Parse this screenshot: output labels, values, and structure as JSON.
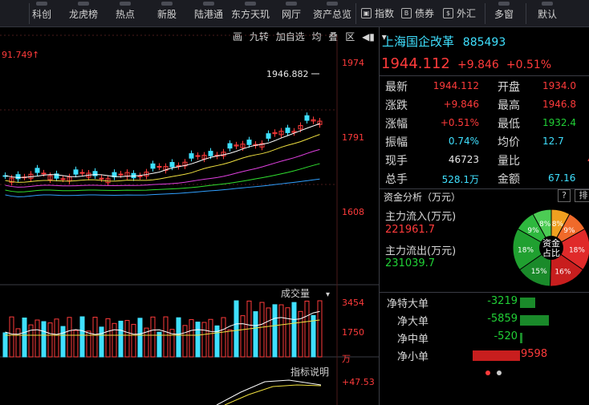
{
  "toolbar": {
    "items": [
      {
        "label": "科创"
      },
      {
        "label": "龙虎榜"
      },
      {
        "label": "热点"
      },
      {
        "label": "新股"
      },
      {
        "label": "陆港通"
      },
      {
        "label": "东方天玑"
      },
      {
        "label": "网厅"
      },
      {
        "label": "资产总览"
      }
    ],
    "small_items": [
      {
        "label": "指数",
        "icon": "chart-box-icon"
      },
      {
        "label": "债券",
        "icon": "bond-box-icon"
      },
      {
        "label": "外汇",
        "icon": "forex-box-icon"
      }
    ],
    "right_items": [
      {
        "label": "多窗"
      },
      {
        "label": "默认"
      }
    ]
  },
  "chart_tools": {
    "draw": "画",
    "nine_turn": "九转",
    "add_self": "加自选",
    "avg": "均",
    "overlay": "叠",
    "range": "区"
  },
  "price_chart": {
    "left_label": "91.749",
    "max_label": "1946.882",
    "y_ticks": [
      "1974",
      "1791",
      "1608"
    ]
  },
  "volume_chart": {
    "title": "成交量",
    "y_ticks": [
      "3454",
      "1750"
    ],
    "unit": "万"
  },
  "indicator_chart": {
    "title": "指标说明",
    "y_tick": "+47.53"
  },
  "quote": {
    "name": "上海国企改革",
    "code": "885493",
    "price": "1944.112",
    "change": "+9.846",
    "pct": "+0.51%",
    "rows": [
      {
        "l1": "最新",
        "v1": "1944.112",
        "l2": "开盘",
        "v2": "1934.0"
      },
      {
        "l1": "涨跌",
        "v1": "+9.846",
        "l2": "最高",
        "v2": "1946.8"
      },
      {
        "l1": "涨幅",
        "v1": "+0.51%",
        "l2": "最低",
        "v2": "1932.4"
      },
      {
        "l1": "振幅",
        "v1": "0.74%",
        "l2": "均价",
        "v2": "12.7"
      },
      {
        "l1": "现手",
        "v1": "46723",
        "l2": "量比",
        "v2": "4"
      },
      {
        "l1": "总手",
        "v1": "528.1万",
        "l2": "金额",
        "v2": "67.16"
      }
    ]
  },
  "fund": {
    "title": "资金分析（万元）",
    "help": "?",
    "sort": "排",
    "inflow_label": "主力流入(万元)",
    "inflow_value": "221961.7",
    "outflow_label": "主力流出(万元)",
    "outflow_value": "231039.7",
    "pie_center": [
      "资金",
      "占比"
    ],
    "pie_slices": [
      {
        "label": "8%",
        "color": "#f0a020"
      },
      {
        "label": "9%",
        "color": "#f06a2a"
      },
      {
        "label": "18%",
        "color": "#e02a2a"
      },
      {
        "label": "16%",
        "color": "#c81e1e"
      },
      {
        "label": "15%",
        "color": "#1a8a2a"
      },
      {
        "label": "18%",
        "color": "#20a030"
      },
      {
        "label": "9%",
        "color": "#2eb83e"
      },
      {
        "label": "8%",
        "color": "#4ccc54"
      }
    ]
  },
  "net_flow": [
    {
      "label": "净特大单",
      "value": "-3219",
      "amount": -3219
    },
    {
      "label": "净大单",
      "value": "-5859",
      "amount": -5859
    },
    {
      "label": "净中单",
      "value": "-520",
      "amount": -520
    },
    {
      "label": "净小单",
      "value": "9598",
      "amount": 9598
    }
  ],
  "colors": {
    "up": "#ff3b3b",
    "down": "#21d036",
    "cyan": "#3fe0ff",
    "bg": "#000000"
  }
}
